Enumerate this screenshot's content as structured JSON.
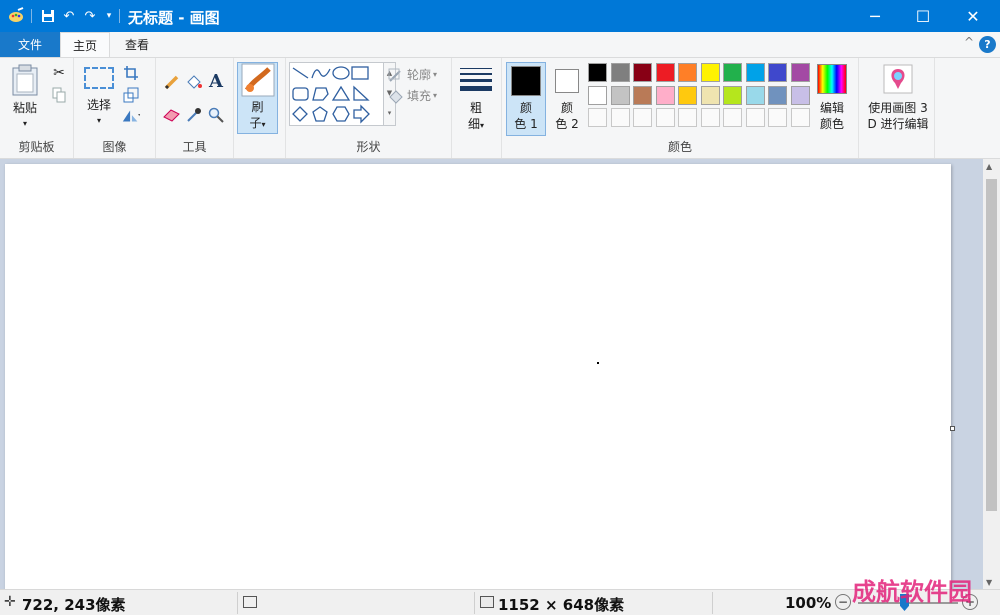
{
  "window": {
    "title": "无标题 - 画图",
    "minimize_glyph": "─",
    "maximize_glyph": "☐",
    "close_glyph": "✕"
  },
  "menu": {
    "file": "文件",
    "tabs": [
      {
        "label": "主页",
        "active": true
      },
      {
        "label": "查看",
        "active": false
      }
    ],
    "help_glyph": "?",
    "collapse_glyph": "^"
  },
  "ribbon": {
    "clipboard": {
      "group_label": "剪贴板",
      "paste_label": "粘贴"
    },
    "image": {
      "group_label": "图像",
      "select_label": "选择"
    },
    "tools": {
      "group_label": "工具",
      "text_glyph": "A"
    },
    "brushes": {
      "label_line1": "刷",
      "label_line2": "子"
    },
    "shapes": {
      "group_label": "形状",
      "outline_label": "轮廓",
      "fill_label": "填充"
    },
    "size": {
      "label_line1": "粗",
      "label_line2": "细"
    },
    "colors": {
      "group_label": "颜色",
      "color1_line1": "颜",
      "color1_line2": "色 1",
      "color2_line1": "颜",
      "color2_line2": "色 2",
      "color1_value": "#000000",
      "color2_value": "#ffffff",
      "palette_row1": [
        "#000000",
        "#7f7f7f",
        "#880015",
        "#ed1c24",
        "#ff7f27",
        "#fff200",
        "#22b14c",
        "#00a2e8",
        "#3f48cc",
        "#a349a4"
      ],
      "palette_row2": [
        "#ffffff",
        "#c3c3c3",
        "#b97a57",
        "#ffaec9",
        "#ffc90e",
        "#efe4b0",
        "#b5e61d",
        "#99d9ea",
        "#7092be",
        "#c8bfe7"
      ],
      "edit_line1": "编辑",
      "edit_line2": "颜色"
    },
    "paint3d": {
      "line1": "使用画图 3",
      "line2": "D 进行编辑"
    }
  },
  "status": {
    "cursor_position": "722, 243像素",
    "canvas_size": "1152 × 648像素",
    "zoom": "100%",
    "zoom_minus": "−",
    "zoom_plus": "+"
  },
  "watermark": "成航软件园"
}
